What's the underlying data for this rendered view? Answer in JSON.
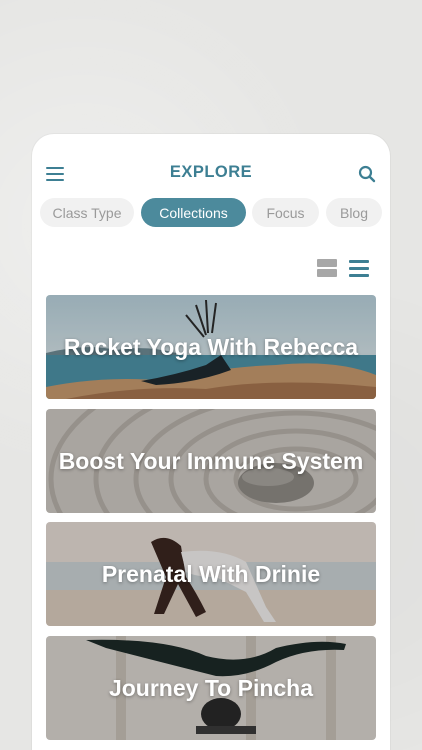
{
  "header": {
    "title": "EXPLORE",
    "menu_icon": "hamburger-menu-icon",
    "search_icon": "search-icon"
  },
  "tabs": [
    {
      "label": "Class Type",
      "active": false
    },
    {
      "label": "Collections",
      "active": true
    },
    {
      "label": "Focus",
      "active": false
    },
    {
      "label": "Blog",
      "active": false
    }
  ],
  "view_toggle": {
    "grid_icon": "grid-view-icon",
    "list_icon": "list-view-icon",
    "selected": "list"
  },
  "collections": [
    {
      "title": "Rocket Yoga With Rebecca"
    },
    {
      "title": "Boost Your Immune System"
    },
    {
      "title": "Prenatal With Drinie"
    },
    {
      "title": "Journey To Pincha"
    }
  ],
  "colors": {
    "accent": "#3d7f93",
    "active_tab": "#4c8a9c",
    "inactive_tab_bg": "#f1f1f1",
    "inactive_tab_text": "#9a9a9a",
    "background": "#e6e6e4"
  }
}
